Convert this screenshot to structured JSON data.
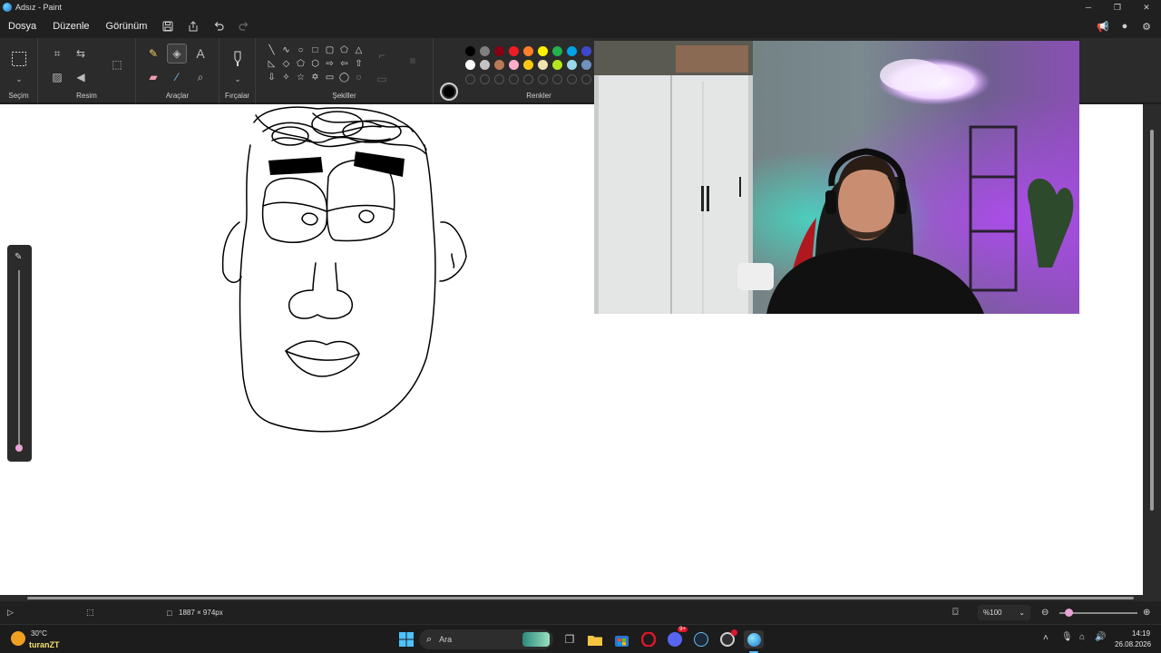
{
  "window": {
    "title": "Adsız - Paint"
  },
  "menu": {
    "items": [
      "Dosya",
      "Düzenle",
      "Görünüm"
    ]
  },
  "ribbon": {
    "groups": {
      "selection": "Seçim",
      "image": "Resim",
      "tools": "Araçlar",
      "brushes": "Fırçalar",
      "shapes": "Şekiller",
      "colors": "Renkler"
    },
    "text_tool_glyph": "A"
  },
  "colors": {
    "current_primary": "#000000",
    "current_secondary": "#ffffff",
    "palette_row1": [
      "#000000",
      "#7f7f7f",
      "#880015",
      "#ed1c24",
      "#ff7f27",
      "#fff200",
      "#22b14c",
      "#00a2e8",
      "#3f48cc"
    ],
    "palette_row2": [
      "#ffffff",
      "#c3c3c3",
      "#b97a57",
      "#ffaec9",
      "#ffc90e",
      "#efe4b0",
      "#b5e61d",
      "#99d9ea",
      "#7092be"
    ],
    "accent_slider_knob": "#e9a3d9"
  },
  "status": {
    "canvas_size": "1887 × 974px",
    "zoom": "%100"
  },
  "taskbar": {
    "weather_temp": "30°C",
    "weather_label": "turanZT",
    "search_placeholder": "Ara",
    "time": "14:19",
    "date": "26.08.2026",
    "discord_badge": "9+"
  }
}
